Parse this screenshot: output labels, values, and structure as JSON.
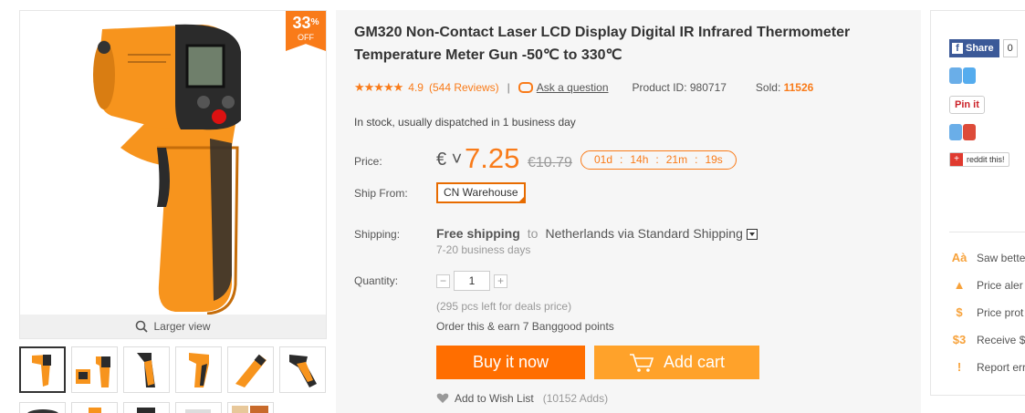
{
  "gallery": {
    "discount_pct": "33",
    "discount_sign": "%",
    "discount_off": "OFF",
    "larger_view_label": "Larger view",
    "thumb_count": 6
  },
  "product": {
    "title": "GM320 Non-Contact Laser LCD Display Digital IR Infrared Thermometer Temperature Meter Gun -50℃ to 330℃",
    "stars": "★★★★★",
    "rating": "4.9",
    "reviews": "(544 Reviews)",
    "separator": "|",
    "ask_question": "Ask a question",
    "product_id": "Product ID: 980717",
    "sold_label": "Sold:",
    "sold_value": "11526",
    "stock": "In stock, usually dispatched in 1 business day"
  },
  "price": {
    "label": "Price:",
    "currency": "€ ˅",
    "value": "7.25",
    "old_value": "€10.79",
    "countdown": {
      "days": "01d",
      "hours": "14h",
      "minutes": "21m",
      "seconds": "19s",
      "sep": ":"
    }
  },
  "ship_from": {
    "label": "Ship From:",
    "value": "CN Warehouse"
  },
  "shipping": {
    "label": "Shipping:",
    "free": "Free shipping",
    "to": "to",
    "destination": "Netherlands via Standard Shipping",
    "days": "7-20 business days"
  },
  "quantity": {
    "label": "Quantity:",
    "minus": "−",
    "value": "1",
    "plus": "+",
    "pcs_left": "(295 pcs left for deals price)",
    "points": "Order this & earn 7 Banggood points"
  },
  "actions": {
    "buy_now": "Buy it now",
    "add_cart": "Add cart",
    "wishlist": "Add to Wish List",
    "wishlist_adds": "(10152 Adds)"
  },
  "share": {
    "facebook_label": "Share",
    "facebook_f": "f",
    "facebook_count": "0",
    "pinterest_label": "Pin it",
    "reddit_label": "reddit this!",
    "reddit_icon": "+"
  },
  "features": [
    {
      "icon": "Aà",
      "label": "Saw bette"
    },
    {
      "icon": "▲",
      "label": "Price aler"
    },
    {
      "icon": "$",
      "label": "Price prot"
    },
    {
      "icon": "$3",
      "label": "Receive $"
    },
    {
      "icon": "!",
      "label": "Report err"
    }
  ],
  "colors": {
    "accent": "#f97b19",
    "buy_button": "#ff6e00",
    "cart_button": "#ffa22a",
    "facebook": "#3b5998"
  }
}
